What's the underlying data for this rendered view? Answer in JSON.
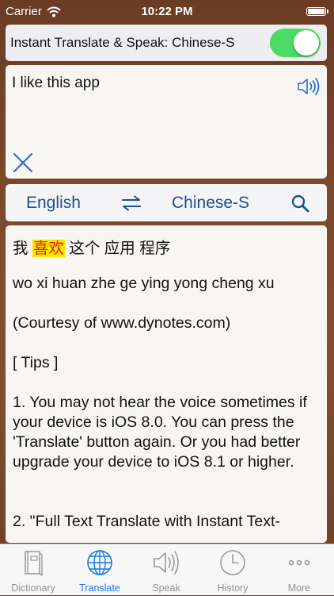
{
  "status_bar": {
    "carrier": "Carrier",
    "time": "10:22 PM"
  },
  "toggle": {
    "label": "Instant Translate & Speak: Chinese-S",
    "on": true,
    "on_color": "#4cd964"
  },
  "input": {
    "text": "I like this app",
    "speaker_icon": "speaker-icon",
    "clear_icon": "close-icon"
  },
  "language_bar": {
    "source": "English",
    "target": "Chinese-S",
    "swap_icon": "swap-arrows-icon",
    "search_icon": "search-icon",
    "text_color": "#1c4f92"
  },
  "output": {
    "chinese": {
      "part1": "我 ",
      "highlight": "喜欢",
      "part2": " 这个 应用 程序"
    },
    "pinyin": "wo xi huan zhe ge ying yong cheng xu",
    "courtesy": "(Courtesy of www.dynotes.com)",
    "tips_header": "[ Tips ]",
    "tip1": "1. You may not hear the voice sometimes if your device is iOS 8.0. You can press the 'Translate' button again. Or you had better upgrade your device to iOS 8.1 or higher.",
    "tip2": "2. \"Full Text Translate with Instant Text-"
  },
  "tab_bar": {
    "active_color": "#1a7ae0",
    "tabs": [
      {
        "label": "Dictionary",
        "icon": "book-icon"
      },
      {
        "label": "Translate",
        "icon": "globe-icon"
      },
      {
        "label": "Speak",
        "icon": "speaker-icon"
      },
      {
        "label": "History",
        "icon": "clock-icon"
      },
      {
        "label": "More",
        "icon": "more-dots-icon"
      }
    ],
    "active_index": 1
  }
}
